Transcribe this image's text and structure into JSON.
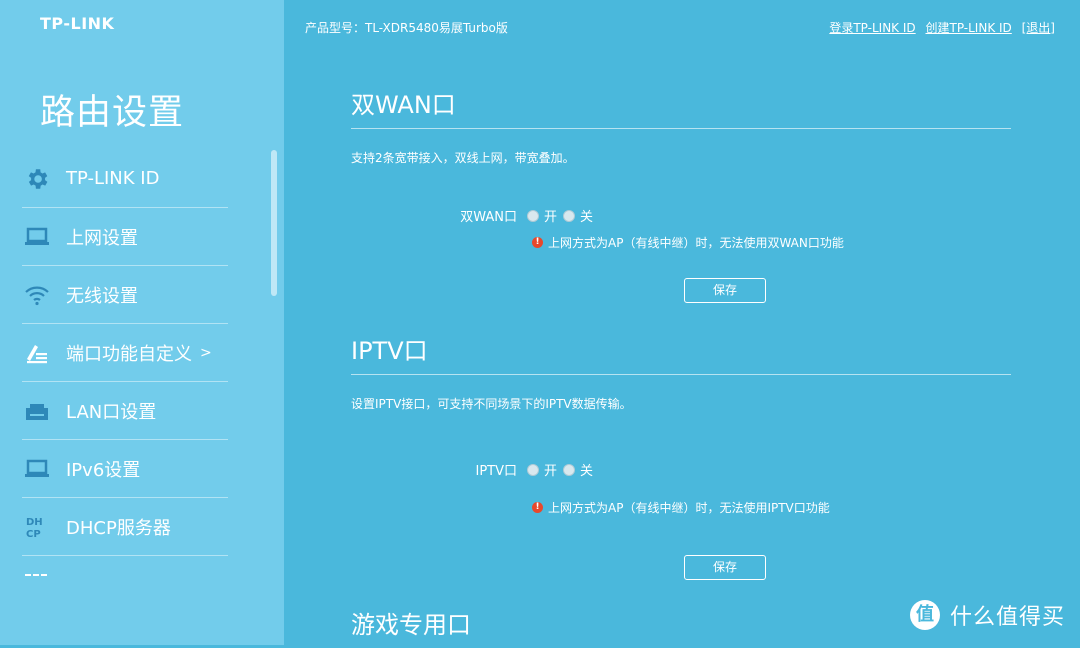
{
  "brand": {
    "logo": "TP-LINK"
  },
  "header": {
    "model_text": "产品型号：TL-XDR5480易展Turbo版",
    "login_link": "登录TP-LINK ID",
    "create_link": "创建TP-LINK ID",
    "logout_link": "[退出]"
  },
  "sidebar": {
    "title": "路由设置",
    "items": [
      {
        "label": "TP-LINK ID",
        "icon": "gear-icon"
      },
      {
        "label": "上网设置",
        "icon": "laptop-icon"
      },
      {
        "label": "无线设置",
        "icon": "wifi-icon"
      },
      {
        "label": "端口功能自定义",
        "icon": "edit-list-icon",
        "arrow": ">"
      },
      {
        "label": "LAN口设置",
        "icon": "ethernet-port-icon"
      },
      {
        "label": "IPv6设置",
        "icon": "laptop-icon"
      },
      {
        "label": "DHCP服务器",
        "icon": "dhcp-icon"
      }
    ]
  },
  "sections": [
    {
      "title": "双WAN口",
      "description": "支持2条宽带接入，双线上网，带宽叠加。",
      "setting_label": "双WAN口",
      "option_on": "开",
      "option_off": "关",
      "warning": "上网方式为AP（有线中继）时，无法使用双WAN口功能",
      "save_label": "保存"
    },
    {
      "title": "IPTV口",
      "description": "设置IPTV接口，可支持不同场景下的IPTV数据传输。",
      "setting_label": "IPTV口",
      "option_on": "开",
      "option_off": "关",
      "warning": "上网方式为AP（有线中继）时，无法使用IPTV口功能",
      "save_label": "保存"
    },
    {
      "title": "游戏专用口"
    }
  ],
  "watermark": {
    "logo_char": "值",
    "text": "什么值得买"
  }
}
